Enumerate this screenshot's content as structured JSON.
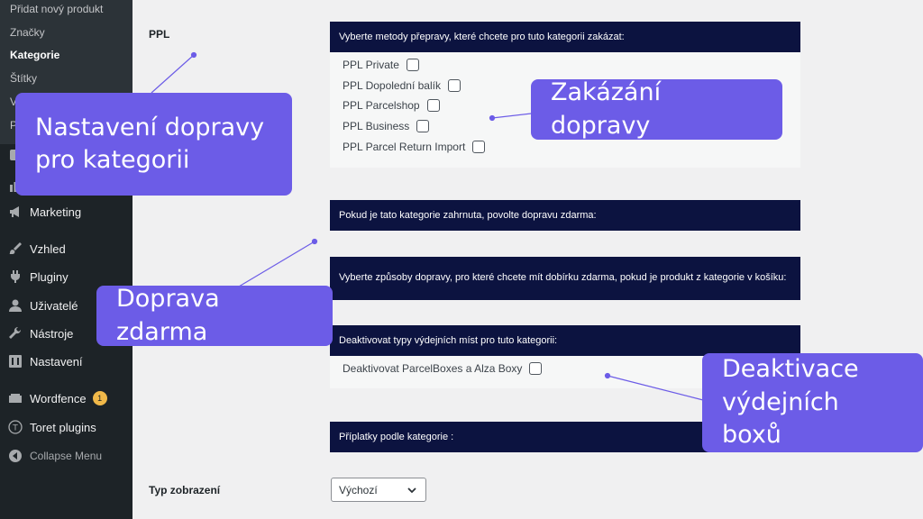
{
  "sidebar": {
    "submenu": [
      "Přidat nový produkt",
      "Značky",
      "Kategorie",
      "Štítky",
      "V",
      "P"
    ],
    "items": [
      {
        "label": "Marketing",
        "icon": "megaphone-icon"
      },
      {
        "label": "Vzhled",
        "icon": "paintbrush-icon"
      },
      {
        "label": "Pluginy",
        "icon": "plug-icon"
      },
      {
        "label": "Uživatelé",
        "icon": "user-icon"
      },
      {
        "label": "Nástroje",
        "icon": "wrench-icon"
      },
      {
        "label": "Nastavení",
        "icon": "settings-icon"
      },
      {
        "label": "Wordfence",
        "icon": "wordfence-icon",
        "badge": "1"
      },
      {
        "label": "Toret plugins",
        "icon": "toret-icon"
      },
      {
        "label": "Collapse Menu",
        "icon": "collapse-icon"
      }
    ]
  },
  "form": {
    "ppl_label": "PPL",
    "disable_methods_heading": "Vyberte metody přepravy, které chcete pro tuto kategorii zakázat:",
    "methods": [
      "PPL Private",
      "PPL Dopolední balík",
      "PPL Parcelshop",
      "PPL Business",
      "PPL Parcel Return Import"
    ],
    "free_shipping_heading": "Pokud je tato kategorie zahrnuta, povolte dopravu zdarma:",
    "free_cod_heading": "Vyberte způsoby dopravy, pro které chcete mít dobírku zdarma, pokud je produkt z kategorie v košíku:",
    "pickup_heading": "Deaktivovat typy výdejních míst pro tuto kategorii:",
    "pickup_option": "Deaktivovat ParcelBoxes a Alza Boxy",
    "surcharge_heading": "Příplatky podle kategorie :",
    "display_type_label": "Typ zobrazení",
    "display_type_value": "Výchozí"
  },
  "callouts": {
    "category_shipping": "Nastavení dopravy pro kategorii",
    "disable_shipping": "Zakázání dopravy",
    "free_shipping": "Doprava zdarma",
    "pickup_deactivation": "Deaktivace výdejních boxů"
  },
  "colors": {
    "sidebar": "#1d2327",
    "navy": "#0c1340",
    "callout": "#6c5ce7",
    "badge": "#f0b849"
  }
}
